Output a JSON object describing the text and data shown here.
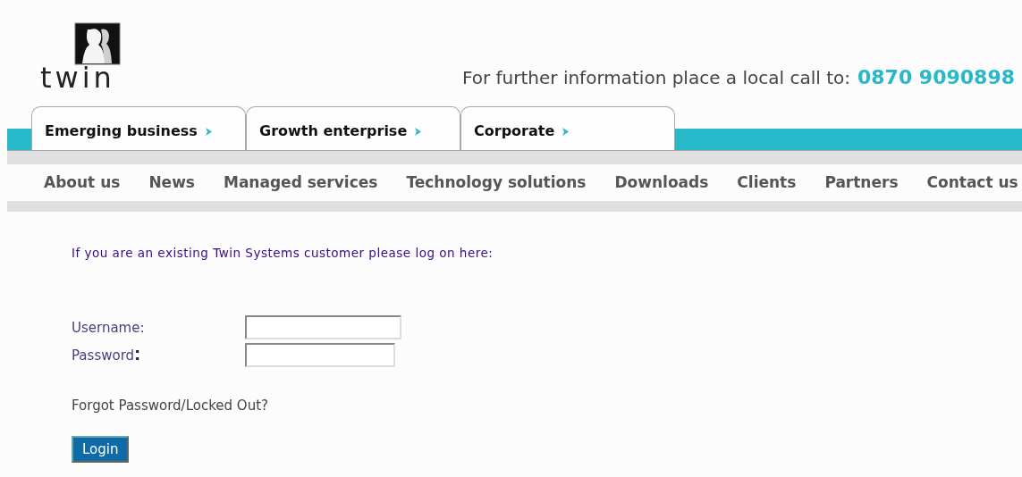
{
  "logo": {
    "text": "twin"
  },
  "contact": {
    "text": "For further information place a local call to:",
    "phone": "0870 9090898"
  },
  "tabs": [
    {
      "label": "Emerging business"
    },
    {
      "label": "Growth enterprise"
    },
    {
      "label": "Corporate"
    }
  ],
  "nav": [
    "About us",
    "News",
    "Managed services",
    "Technology solutions",
    "Downloads",
    "Clients",
    "Partners",
    "Contact us"
  ],
  "login": {
    "intro": "If you are an existing Twin Systems customer please log on here:",
    "username_label": "Username:",
    "password_label": "Password",
    "password_colon": ":",
    "forgot": "Forgot Password/Locked Out?",
    "button": "Login"
  }
}
